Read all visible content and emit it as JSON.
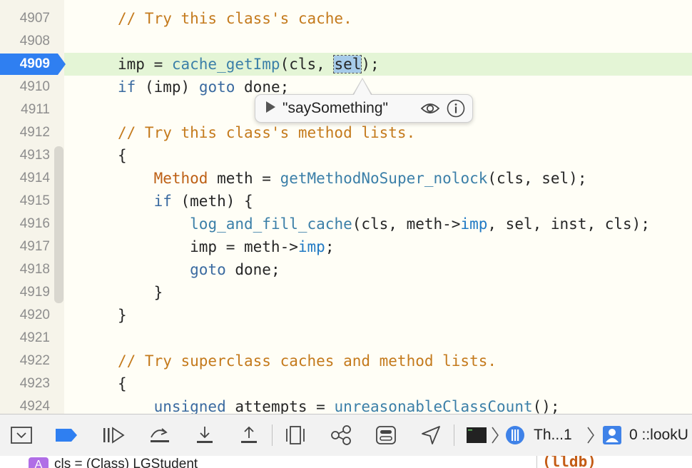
{
  "editor": {
    "breakpoint_line": "4909",
    "lines": [
      {
        "num": "4907",
        "tokens": [
          {
            "t": "// Try this class's cache.",
            "c": "tok-c"
          }
        ]
      },
      {
        "num": "4908",
        "tokens": []
      },
      {
        "num": "4909",
        "tokens": [
          {
            "t": "imp = "
          },
          {
            "t": "cache_getImp",
            "c": "tok-f"
          },
          {
            "t": "(cls, "
          },
          {
            "t": "sel",
            "c": "sel-box"
          },
          {
            "t": ");"
          }
        ]
      },
      {
        "num": "4910",
        "tokens": [
          {
            "t": "if",
            "c": "tok-k"
          },
          {
            "t": " (imp) "
          },
          {
            "t": "goto",
            "c": "tok-k"
          },
          {
            "t": " done;"
          }
        ]
      },
      {
        "num": "4911",
        "tokens": []
      },
      {
        "num": "4912",
        "tokens": [
          {
            "t": "// Try this class's method lists.",
            "c": "tok-c"
          }
        ]
      },
      {
        "num": "4913",
        "tokens": [
          {
            "t": "{"
          }
        ]
      },
      {
        "num": "4914",
        "tokens": [
          {
            "t": "    "
          },
          {
            "t": "Method",
            "c": "tok-t"
          },
          {
            "t": " meth = "
          },
          {
            "t": "getMethodNoSuper_nolock",
            "c": "tok-f"
          },
          {
            "t": "(cls, sel);"
          }
        ]
      },
      {
        "num": "4915",
        "tokens": [
          {
            "t": "    "
          },
          {
            "t": "if",
            "c": "tok-k"
          },
          {
            "t": " (meth) {"
          }
        ]
      },
      {
        "num": "4916",
        "tokens": [
          {
            "t": "        "
          },
          {
            "t": "log_and_fill_cache",
            "c": "tok-f"
          },
          {
            "t": "(cls, meth->"
          },
          {
            "t": "imp",
            "c": "tok-m"
          },
          {
            "t": ", sel, inst, cls);"
          }
        ]
      },
      {
        "num": "4917",
        "tokens": [
          {
            "t": "        imp = meth->"
          },
          {
            "t": "imp",
            "c": "tok-m"
          },
          {
            "t": ";"
          }
        ]
      },
      {
        "num": "4918",
        "tokens": [
          {
            "t": "        "
          },
          {
            "t": "goto",
            "c": "tok-k"
          },
          {
            "t": " done;"
          }
        ]
      },
      {
        "num": "4919",
        "tokens": [
          {
            "t": "    }"
          }
        ]
      },
      {
        "num": "4920",
        "tokens": [
          {
            "t": "}"
          }
        ]
      },
      {
        "num": "4921",
        "tokens": []
      },
      {
        "num": "4922",
        "tokens": [
          {
            "t": "// Try superclass caches and method lists.",
            "c": "tok-c"
          }
        ]
      },
      {
        "num": "4923",
        "tokens": [
          {
            "t": "{"
          }
        ]
      },
      {
        "num": "4924",
        "tokens": [
          {
            "t": "    "
          },
          {
            "t": "unsigned",
            "c": "tok-k"
          },
          {
            "t": " attempts = "
          },
          {
            "t": "unreasonableClassCount",
            "c": "tok-f"
          },
          {
            "t": "();"
          }
        ]
      }
    ]
  },
  "popover": {
    "value": "\"saySomething\"",
    "icons": [
      "play-icon",
      "eye-icon",
      "info-icon"
    ]
  },
  "debug_bar": {
    "icons": [
      "hide-debug-area-icon",
      "breakpoints-toggle-icon",
      "continue-icon",
      "step-over-icon",
      "step-into-icon",
      "step-out-icon",
      "view-hierarchy-icon",
      "memory-graph-icon",
      "environment-overrides-icon",
      "simulate-location-icon"
    ],
    "thread_label": "Th...1",
    "frame_label": "0 ::lookU"
  },
  "variables": {
    "badge": "A",
    "row_text": "cls = (Class) LGStudent"
  },
  "console": {
    "prompt": "(lldb)"
  },
  "colors": {
    "breakpoint": "#2f7ff1",
    "current_line": "#e4f5d6",
    "comment": "#c47a1c",
    "keyword": "#3a6aa0",
    "function": "#3b7fa8"
  }
}
